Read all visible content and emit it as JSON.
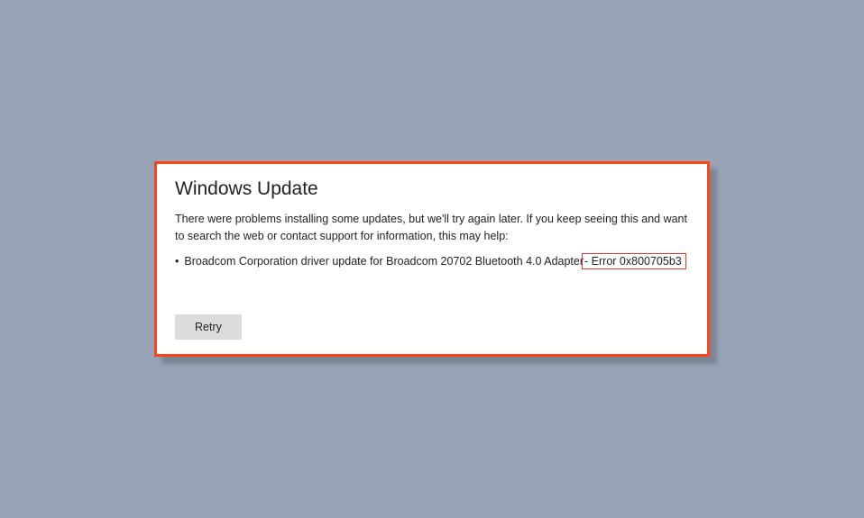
{
  "dialog": {
    "title": "Windows Update",
    "description": "There were problems installing some updates, but we'll try again later. If you keep seeing this and want to search the web or contact support for information, this may help:",
    "update_item": "Broadcom Corporation driver update for Broadcom 20702 Bluetooth 4.0 Adapter",
    "error_code": " - Error 0x800705b3",
    "retry_label": "Retry"
  }
}
